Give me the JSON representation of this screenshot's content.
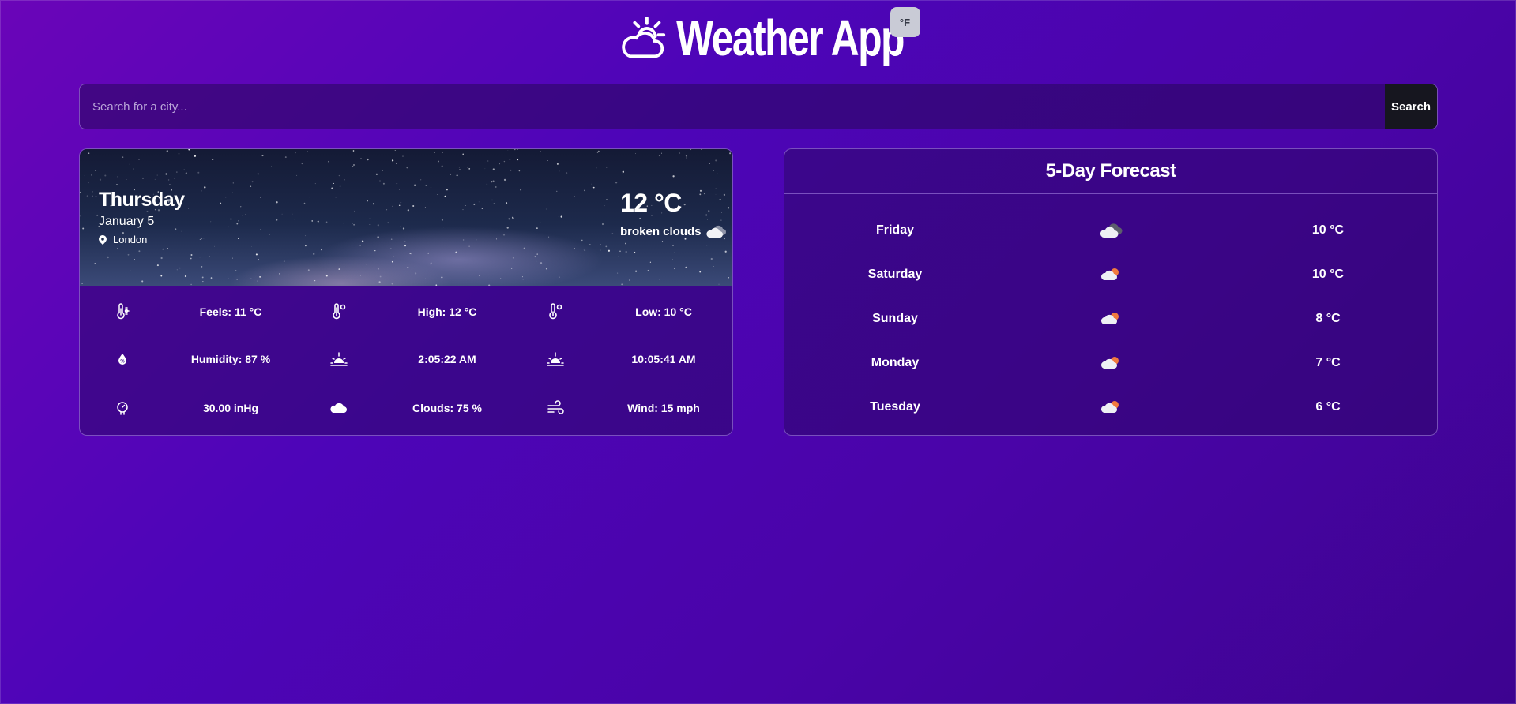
{
  "app": {
    "title": "Weather App",
    "unit_toggle": "°F",
    "colors": {
      "bg_start": "#6a05b8",
      "bg_end": "#3d0390",
      "button_dark": "#16161f",
      "toggle_bg": "#c9cbd6"
    },
    "icon": "sun-cloud-icon"
  },
  "search": {
    "placeholder": "Search for a city...",
    "button_label": "Search"
  },
  "current": {
    "day": "Thursday",
    "date": "January 5",
    "city": "London",
    "temp": "12 °C",
    "description": "broken clouds",
    "stats": [
      {
        "icon": "thermometer-sun-icon",
        "text": "Feels: 11 °C"
      },
      {
        "icon": "thermometer-high-icon",
        "text": "High: 12 °C"
      },
      {
        "icon": "thermometer-low-icon",
        "text": "Low: 10 °C"
      },
      {
        "icon": "humidity-icon",
        "text": "Humidity: 87 %"
      },
      {
        "icon": "sunrise-icon",
        "text": "2:05:22 AM"
      },
      {
        "icon": "sunset-icon",
        "text": "10:05:41 AM"
      },
      {
        "icon": "pressure-icon",
        "text": "30.00 inHg"
      },
      {
        "icon": "cloud-icon",
        "text": "Clouds: 75 %"
      },
      {
        "icon": "wind-icon",
        "text": "Wind: 15 mph"
      }
    ]
  },
  "forecast": {
    "title": "5-Day Forecast",
    "days": [
      {
        "day": "Friday",
        "icon": "broken-clouds-icon",
        "temp": "10 °C"
      },
      {
        "day": "Saturday",
        "icon": "few-clouds-day-icon",
        "temp": "10 °C"
      },
      {
        "day": "Sunday",
        "icon": "few-clouds-day-icon",
        "temp": "8 °C"
      },
      {
        "day": "Monday",
        "icon": "few-clouds-day-icon",
        "temp": "7 °C"
      },
      {
        "day": "Tuesday",
        "icon": "few-clouds-day-icon",
        "temp": "6 °C"
      }
    ]
  }
}
